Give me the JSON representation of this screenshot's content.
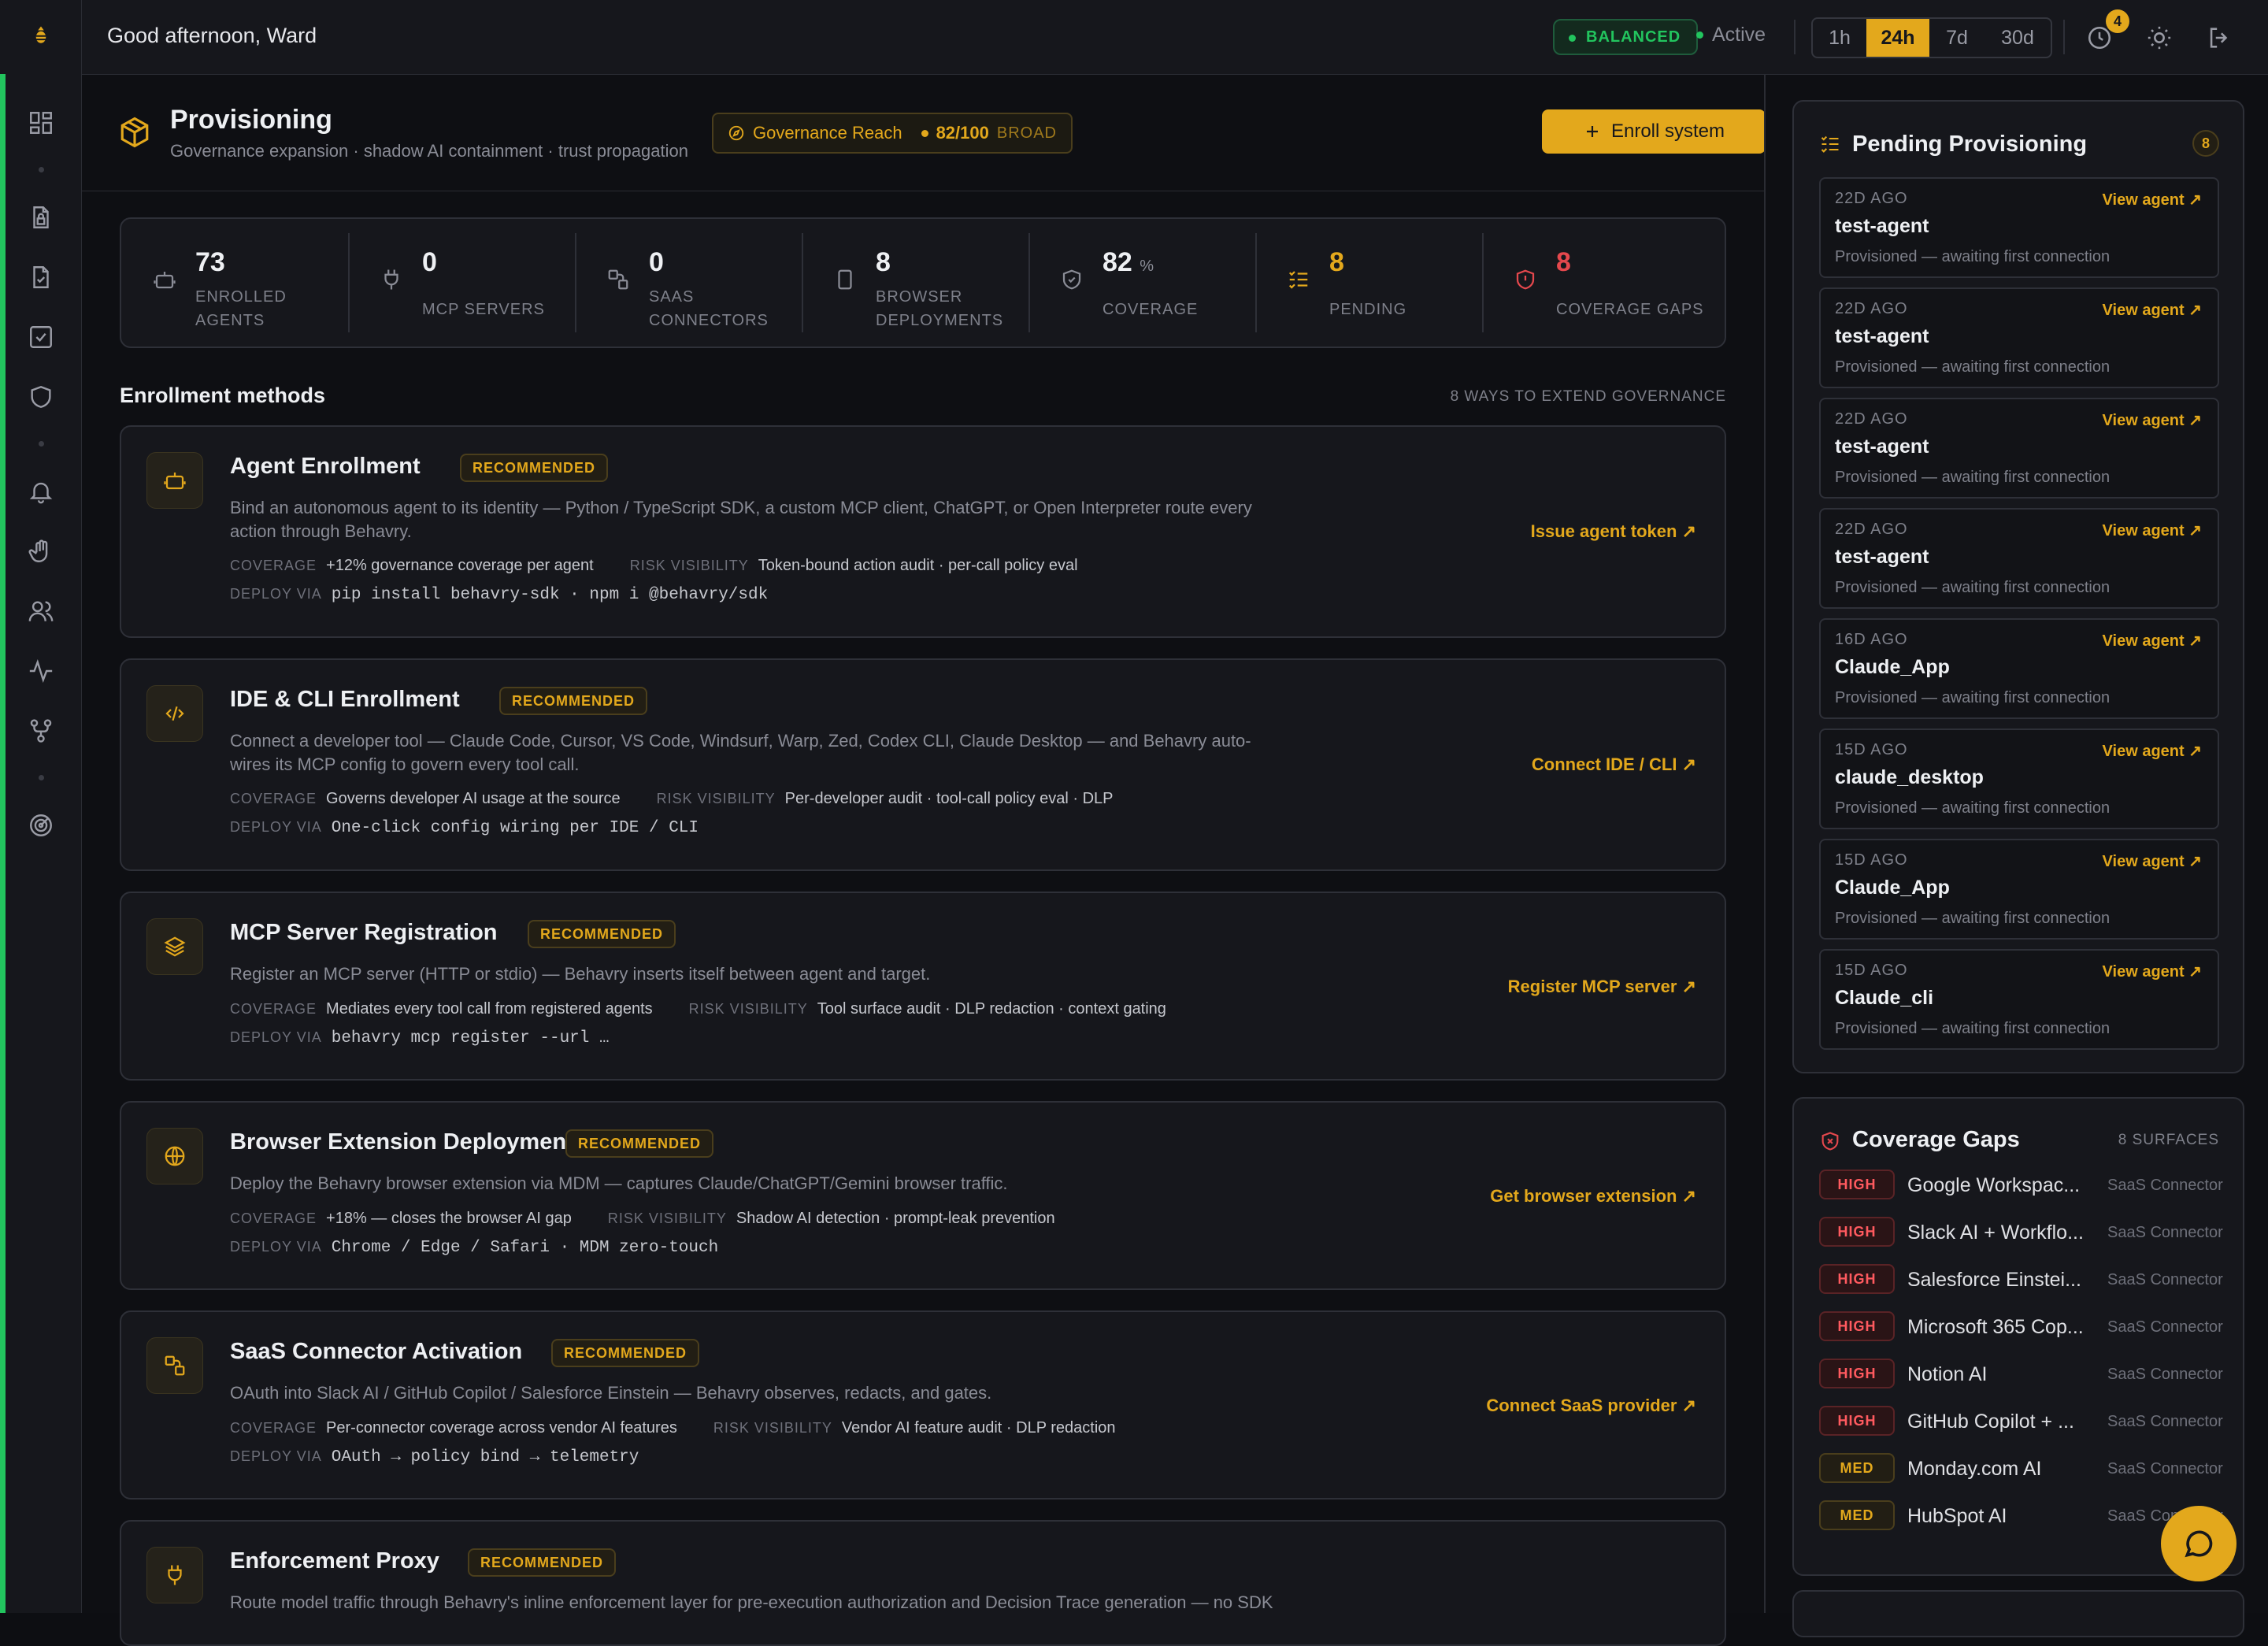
{
  "topbar": {
    "greeting": "Good afternoon, Ward",
    "mode": "BALANCED",
    "status": "Active",
    "ranges": [
      "1h",
      "24h",
      "7d",
      "30d"
    ],
    "active_range": "24h",
    "notification_count": "4"
  },
  "page": {
    "title": "Provisioning",
    "subtitle": "Governance expansion · shadow AI containment · trust propagation",
    "reach_label": "Governance Reach",
    "reach_score": "82/100",
    "reach_level": "BROAD",
    "enroll_button": "Enroll system"
  },
  "stats": [
    {
      "value": "73",
      "label": "ENROLLED AGENTS",
      "icon": "robot-icon"
    },
    {
      "value": "0",
      "label": "MCP SERVERS",
      "icon": "plug-icon"
    },
    {
      "value": "0",
      "label": "SAAS CONNECTORS",
      "icon": "connector-icon"
    },
    {
      "value": "8",
      "label": "BROWSER DEPLOYMENTS",
      "icon": "browser-icon"
    },
    {
      "value": "82",
      "unit": "%",
      "label": "COVERAGE",
      "icon": "shield-check-icon"
    },
    {
      "value": "8",
      "label": "PENDING",
      "icon": "pending-list-icon"
    },
    {
      "value": "8",
      "label": "COVERAGE GAPS",
      "icon": "shield-alert-icon"
    }
  ],
  "enrollment": {
    "heading": "Enrollment methods",
    "count_label": "8 WAYS TO EXTEND GOVERNANCE",
    "coverage_key": "COVERAGE",
    "risk_key": "RISK VISIBILITY",
    "deploy_key": "DEPLOY VIA",
    "methods": [
      {
        "title": "Agent Enrollment",
        "badge": "RECOMMENDED",
        "icon": "robot-icon",
        "description": "Bind an autonomous agent to its identity — Python / TypeScript SDK, a custom MCP client, ChatGPT, or Open Interpreter route every action through Behavry.",
        "coverage": "+12% governance coverage per agent",
        "risk": "Token-bound action audit · per-call policy eval",
        "deploy": "pip install behavry-sdk · npm i @behavry/sdk",
        "action": "Issue agent token"
      },
      {
        "title": "IDE & CLI Enrollment",
        "badge": "RECOMMENDED",
        "icon": "code-icon",
        "description": "Connect a developer tool — Claude Code, Cursor, VS Code, Windsurf, Warp, Zed, Codex CLI, Claude Desktop — and Behavry auto-wires its MCP config to govern every tool call.",
        "coverage": "Governs developer AI usage at the source",
        "risk": "Per-developer audit · tool-call policy eval · DLP",
        "deploy": "One-click config wiring per IDE / CLI",
        "action": "Connect IDE / CLI"
      },
      {
        "title": "MCP Server Registration",
        "badge": "RECOMMENDED",
        "icon": "layers-icon",
        "description": "Register an MCP server (HTTP or stdio) — Behavry inserts itself between agent and target.",
        "coverage": "Mediates every tool call from registered agents",
        "risk": "Tool surface audit · DLP redaction · context gating",
        "deploy": "behavry mcp register --url …",
        "action": "Register MCP server"
      },
      {
        "title": "Browser Extension Deployment",
        "badge": "RECOMMENDED",
        "icon": "globe-icon",
        "description": "Deploy the Behavry browser extension via MDM — captures Claude/ChatGPT/Gemini browser traffic.",
        "coverage": "+18% — closes the browser AI gap",
        "risk": "Shadow AI detection · prompt-leak prevention",
        "deploy": "Chrome / Edge / Safari · MDM zero-touch",
        "action": "Get browser extension"
      },
      {
        "title": "SaaS Connector Activation",
        "badge": "RECOMMENDED",
        "icon": "connector-icon",
        "description": "OAuth into Slack AI / GitHub Copilot / Salesforce Einstein — Behavry observes, redacts, and gates.",
        "coverage": "Per-connector coverage across vendor AI features",
        "risk": "Vendor AI feature audit · DLP redaction",
        "deploy": "OAuth → policy bind → telemetry",
        "action": "Connect SaaS provider"
      },
      {
        "title": "Enforcement Proxy",
        "badge": "RECOMMENDED",
        "icon": "plug-icon",
        "description": "Route model traffic through Behavry's inline enforcement layer for pre-execution authorization and Decision Trace generation — no SDK"
      }
    ]
  },
  "pending": {
    "title": "Pending Provisioning",
    "count": "8",
    "link_label": "View agent",
    "items": [
      {
        "ago": "22D AGO",
        "name": "test-agent",
        "status": "Provisioned — awaiting first connection"
      },
      {
        "ago": "22D AGO",
        "name": "test-agent",
        "status": "Provisioned — awaiting first connection"
      },
      {
        "ago": "22D AGO",
        "name": "test-agent",
        "status": "Provisioned — awaiting first connection"
      },
      {
        "ago": "22D AGO",
        "name": "test-agent",
        "status": "Provisioned — awaiting first connection"
      },
      {
        "ago": "16D AGO",
        "name": "Claude_App",
        "status": "Provisioned — awaiting first connection"
      },
      {
        "ago": "15D AGO",
        "name": "claude_desktop",
        "status": "Provisioned — awaiting first connection"
      },
      {
        "ago": "15D AGO",
        "name": "Claude_App",
        "status": "Provisioned — awaiting first connection"
      },
      {
        "ago": "15D AGO",
        "name": "Claude_cli",
        "status": "Provisioned — awaiting first connection"
      }
    ]
  },
  "gaps": {
    "title": "Coverage Gaps",
    "surfaces": "8 SURFACES",
    "items": [
      {
        "severity": "HIGH",
        "name": "Google Workspac...",
        "type": "SaaS Connector"
      },
      {
        "severity": "HIGH",
        "name": "Slack AI + Workflo...",
        "type": "SaaS Connector"
      },
      {
        "severity": "HIGH",
        "name": "Salesforce Einstei...",
        "type": "SaaS Connector"
      },
      {
        "severity": "HIGH",
        "name": "Microsoft 365 Cop...",
        "type": "SaaS Connector"
      },
      {
        "severity": "HIGH",
        "name": "Notion AI",
        "type": "SaaS Connector"
      },
      {
        "severity": "HIGH",
        "name": "GitHub Copilot + ...",
        "type": "SaaS Connector"
      },
      {
        "severity": "MED",
        "name": "Monday.com AI",
        "type": "SaaS Connector"
      },
      {
        "severity": "MED",
        "name": "HubSpot AI",
        "type": "SaaS Connector"
      }
    ]
  },
  "colors": {
    "accent": "#e3a81c",
    "success": "#22c55e",
    "danger": "#e5484d",
    "background": "#0e0f13"
  }
}
